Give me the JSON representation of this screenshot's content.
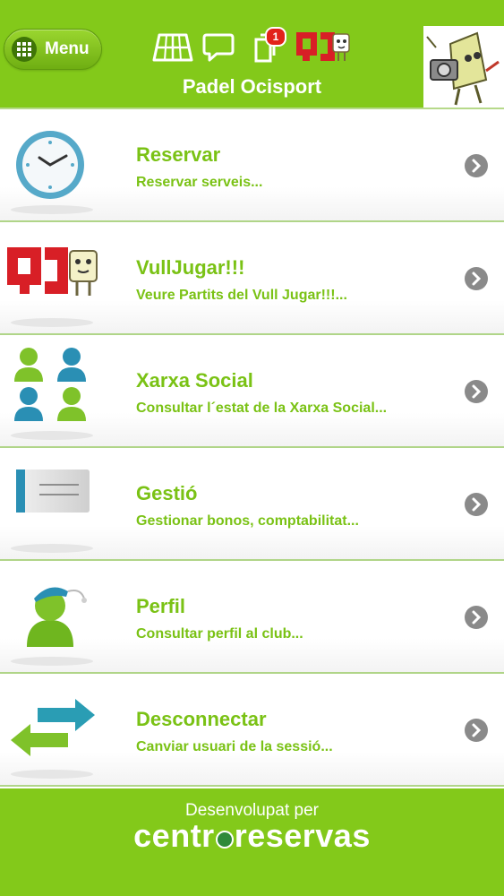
{
  "header": {
    "menu_label": "Menu",
    "title": "Padel Ocisport",
    "notification_count": "1",
    "icons": [
      "court-icon",
      "chat-icon",
      "notifications-icon",
      "vulljugar-logo-icon"
    ]
  },
  "menu": [
    {
      "title": "Reservar",
      "subtitle": "Reservar serveis...",
      "icon": "clock-icon"
    },
    {
      "title": "VullJugar!!!",
      "subtitle": "Veure Partits del Vull Jugar!!!...",
      "icon": "vulljugar-icon"
    },
    {
      "title": "Xarxa Social",
      "subtitle": "Consultar l´estat de la Xarxa Social...",
      "icon": "people-icon"
    },
    {
      "title": "Gestió",
      "subtitle": "Gestionar bonos, comptabilitat...",
      "icon": "card-icon"
    },
    {
      "title": "Perfil",
      "subtitle": "Consultar perfil al club...",
      "icon": "user-profile-icon"
    },
    {
      "title": "Desconnectar",
      "subtitle": "Canviar usuari de la sessió...",
      "icon": "switch-arrows-icon"
    }
  ],
  "footer": {
    "label": "Desenvolupat per",
    "brand_left": "centr",
    "brand_right": "reservas"
  },
  "colors": {
    "brand_green": "#83c91a",
    "text_green": "#7ac215",
    "badge_red": "#e2231a"
  }
}
